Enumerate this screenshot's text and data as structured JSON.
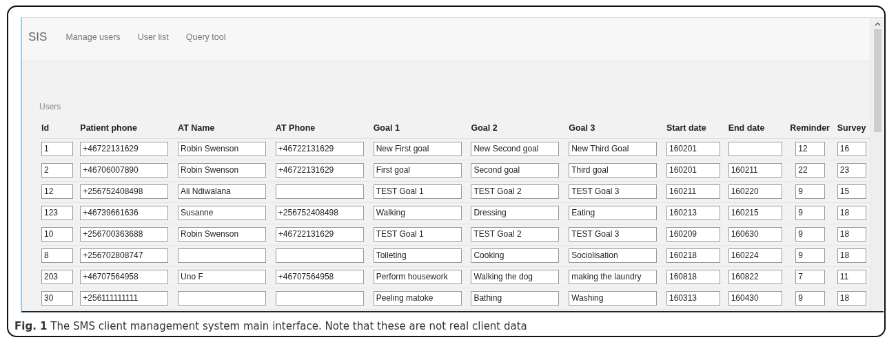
{
  "navbar": {
    "brand": "SIS",
    "links": [
      "Manage users",
      "User list",
      "Query tool"
    ]
  },
  "section_title": "Users",
  "table": {
    "columns": [
      "Id",
      "Patient phone",
      "AT Name",
      "AT Phone",
      "Goal 1",
      "Goal 2",
      "Goal 3",
      "Start date",
      "End date",
      "Reminder",
      "Survey"
    ],
    "rows": [
      {
        "id": "1",
        "patient_phone": "+46722131629",
        "at_name": "Robin Swenson",
        "at_phone": "+46722131629",
        "goal_1": "New First goal",
        "goal_2": "New Second goal",
        "goal_3": "New Third Goal",
        "start_date": "160201",
        "reminder": "12",
        "survey": "16"
      },
      {
        "id": "2",
        "patient_phone": "+46706007890",
        "at_name": "Robin Swenson",
        "at_phone": "+46722131629",
        "goal_1": "First goal",
        "goal_2": "Second goal",
        "goal_3": "Third goal",
        "start_date": "160201",
        "end_date": "160211",
        "reminder": "22",
        "survey": "23"
      },
      {
        "id": "12",
        "patient_phone": "+256752408498",
        "at_name": "Ali Ndiwalana",
        "goal_1": "TEST Goal 1",
        "goal_2": "TEST Goal 2",
        "goal_3": "TEST Goal 3",
        "start_date": "160211",
        "end_date": "160220",
        "reminder": "9",
        "survey": "15"
      },
      {
        "id": "123",
        "patient_phone": "+46739661636",
        "at_name": "Susanne",
        "at_phone": "+256752408498",
        "goal_1": "Walking",
        "goal_2": "Dressing",
        "goal_3": "Eating",
        "start_date": "160213",
        "end_date": "160215",
        "reminder": "9",
        "survey": "18"
      },
      {
        "id": "10",
        "patient_phone": "+256700363688",
        "at_name": "Robin Swenson",
        "at_phone": "+46722131629",
        "goal_1": "TEST Goal 1",
        "goal_2": "TEST Goal 2",
        "goal_3": "TEST Goal 3",
        "start_date": "160209",
        "end_date": "160630",
        "reminder": "9",
        "survey": "18"
      },
      {
        "id": "8",
        "patient_phone": "+256702808747",
        "goal_1": "Toileting",
        "goal_2": "Cooking",
        "goal_3": "Sociolisation",
        "start_date": "160218",
        "end_date": "160224",
        "reminder": "9",
        "survey": "18"
      },
      {
        "id": "203",
        "patient_phone": "+46707564958",
        "at_name": "Uno F",
        "at_phone": "+46707564958",
        "goal_1": "Perform housework",
        "goal_2": "Walking the dog",
        "goal_3": "making the laundry",
        "start_date": "160818",
        "end_date": "160822",
        "reminder": "7",
        "survey": "11"
      },
      {
        "id": "30",
        "patient_phone": "+256111111111",
        "goal_1": "Peeling matoke",
        "goal_2": "Bathing",
        "goal_3": "Washing",
        "start_date": "160313",
        "end_date": "160430",
        "reminder": "9",
        "survey": "18"
      }
    ]
  },
  "caption": "**Fig. 1** The SMS client management system main interface. Note that these are not real client data"
}
